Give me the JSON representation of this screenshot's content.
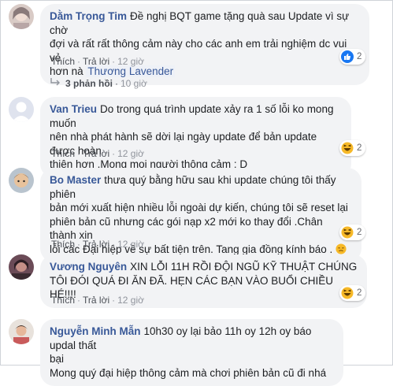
{
  "comments": [
    {
      "author": "Dằm Trọng Tim",
      "text_lines": [
        "Đề nghị BQT game tặng quà sau Update vì sự chờ",
        "đợi và rất rất thông cảm này cho các anh em trải nghiệm dc vui vẻ",
        "hơn nà"
      ],
      "mention": "Thương Lavender",
      "actions": {
        "like": "Thích",
        "reply": "Trả lời",
        "time": "12 giờ"
      },
      "reaction": {
        "icon": "like-icon",
        "count": "2"
      },
      "replies": {
        "count": "3 phản hồi",
        "time": "10 giờ"
      }
    },
    {
      "author": "Van Trieu",
      "text_lines": [
        "Do trong quá trình update xảy ra 1 số lỗi ko mong muốn",
        "nên nhà phát hành sẽ dời lại ngày update để bản update được hoàn",
        "thiện hơn .Mong mọi người thông cảm : D"
      ],
      "actions": {
        "like": "Thích",
        "reply": "Trả lời",
        "time": "12 giờ"
      },
      "reaction": {
        "icon": "haha-icon",
        "count": "2"
      }
    },
    {
      "author": "Bo Master",
      "text_lines": [
        "thưa quý bằng hữu sau khi update chúng tôi thấy phiên",
        "bản mới xuất hiện nhiều lỗi ngoài dự kiến, chúng tôi sẽ reset lại",
        "phiên bản cũ nhưng các gói nạp x2 mới ko thay đổi .Chân thành xin",
        "lỗi các Đại hiệp về sự bất tiện trên. Tang gia đồng kính báo ."
      ],
      "actions": {
        "like": "Thích",
        "reply": "Trả lời",
        "time": "12 giờ"
      },
      "reaction": {
        "icon": "haha-icon",
        "count": "2"
      }
    },
    {
      "author": "Vương Nguyên",
      "text_lines": [
        "XIN LỖI 11H RỒI ĐỘI NGŨ KỸ THUẬT CHÚNG",
        "TÔI ĐÓI QUÁ ĐI ĂN ĐÃ. HẸN CÁC BẠN VÀO BUỔI CHIỀU HÉ!!!!"
      ],
      "actions": {
        "like": "Thích",
        "reply": "Trả lời",
        "time": "12 giờ"
      },
      "reaction": {
        "icon": "haha-icon",
        "count": "2"
      }
    },
    {
      "author": "Nguyễn Minh Mẫn",
      "text_lines": [
        "10h30 oy lại bảo 11h oy 12h oy báo updal thất",
        "bại",
        "Mong quý đại hiệp thông cảm mà chơi phiên bản cũ đi nhá"
      ]
    }
  ],
  "colors": {
    "author": "#385898",
    "bubble": "#f2f3f5",
    "like": "#1877f2",
    "haha": "#f7b928"
  }
}
